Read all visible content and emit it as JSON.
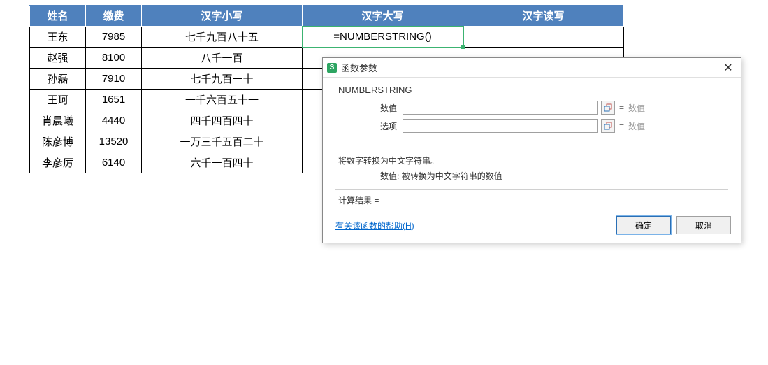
{
  "table": {
    "headers": [
      "姓名",
      "缴费",
      "汉字小写",
      "汉字大写",
      "汉字读写"
    ],
    "rows": [
      {
        "name": "王东",
        "fee": "7985",
        "lower": "七千九百八十五",
        "upper": "=NUMBERSTRING()",
        "read": ""
      },
      {
        "name": "赵强",
        "fee": "8100",
        "lower": "八千一百",
        "upper": "",
        "read": ""
      },
      {
        "name": "孙磊",
        "fee": "7910",
        "lower": "七千九百一十",
        "upper": "",
        "read": ""
      },
      {
        "name": "王珂",
        "fee": "1651",
        "lower": "一千六百五十一",
        "upper": "",
        "read": ""
      },
      {
        "name": "肖晨曦",
        "fee": "4440",
        "lower": "四千四百四十",
        "upper": "",
        "read": ""
      },
      {
        "name": "陈彦博",
        "fee": "13520",
        "lower": "一万三千五百二十",
        "upper": "",
        "read": ""
      },
      {
        "name": "李彦厉",
        "fee": "6140",
        "lower": "六千一百四十",
        "upper": "",
        "read": ""
      }
    ]
  },
  "dialog": {
    "logo_letter": "S",
    "title": "函数参数",
    "function_name": "NUMBERSTRING",
    "params": [
      {
        "label": "数值",
        "value": "",
        "hint": "数值"
      },
      {
        "label": "选项",
        "value": "",
        "hint": "数值"
      }
    ],
    "equals_symbol": "=",
    "description": "将数字转换为中文字符串。",
    "param_help_label": "数值:",
    "param_help_text": "被转换为中文字符串的数值",
    "calc_result_label": "计算结果 =",
    "help_link": "有关该函数的帮助(H)",
    "ok_button": "确定",
    "cancel_button": "取消"
  }
}
